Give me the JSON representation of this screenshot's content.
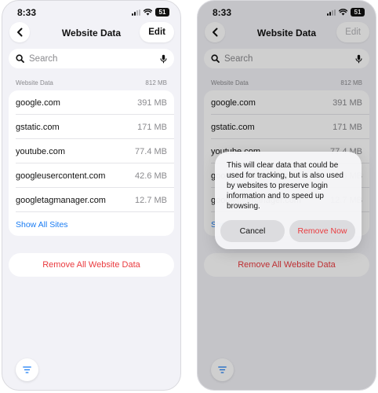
{
  "status_bar": {
    "time": "8:33",
    "battery": "51"
  },
  "nav": {
    "title": "Website Data",
    "edit_label": "Edit"
  },
  "search": {
    "placeholder": "Search"
  },
  "section": {
    "header": "Website Data",
    "total": "812 MB"
  },
  "sites": [
    {
      "domain": "google.com",
      "size": "391 MB"
    },
    {
      "domain": "gstatic.com",
      "size": "171 MB"
    },
    {
      "domain": "youtube.com",
      "size": "77.4 MB"
    },
    {
      "domain": "googleusercontent.com",
      "size": "42.6 MB"
    },
    {
      "domain": "googletagmanager.com",
      "size": "12.7 MB"
    }
  ],
  "show_all_label": "Show All Sites",
  "remove_all_label": "Remove All Website Data",
  "alert": {
    "message": "This will clear data that could be used for tracking, but is also used by websites to preserve login information and to speed up browsing.",
    "cancel_label": "Cancel",
    "remove_label": "Remove Now"
  },
  "icons": {
    "back": "chevron-left-icon",
    "search": "magnifier-icon",
    "mic": "microphone-icon",
    "filter": "filter-lines-icon",
    "signal": "cellular-signal-icon",
    "wifi": "wifi-icon",
    "battery": "battery-icon"
  },
  "colors": {
    "accent_blue": "#1a7cf3",
    "destructive_red": "#ea3b3f",
    "background": "#f2f2f7",
    "card": "#ffffff"
  }
}
